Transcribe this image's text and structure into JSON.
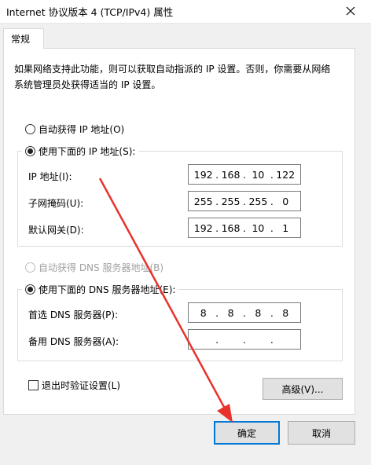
{
  "window": {
    "title": "Internet 协议版本 4 (TCP/IPv4) 属性"
  },
  "tabs": [
    {
      "label": "常规"
    }
  ],
  "description": "如果网络支持此功能，则可以获取自动指派的 IP 设置。否则，你需要从网络系统管理员处获得适当的 IP 设置。",
  "ip_section": {
    "auto_label": "自动获得 IP 地址(O)",
    "manual_label": "使用下面的 IP 地址(S):",
    "fields": [
      {
        "label": "IP 地址(I):",
        "octets": [
          "192",
          "168",
          "10",
          "122"
        ]
      },
      {
        "label": "子网掩码(U):",
        "octets": [
          "255",
          "255",
          "255",
          "0"
        ]
      },
      {
        "label": "默认网关(D):",
        "octets": [
          "192",
          "168",
          "10",
          "1"
        ]
      }
    ]
  },
  "dns_section": {
    "auto_label": "自动获得 DNS 服务器地址(B)",
    "manual_label": "使用下面的 DNS 服务器地址(E):",
    "fields": [
      {
        "label": "首选 DNS 服务器(P):",
        "octets": [
          "8",
          "8",
          "8",
          "8"
        ]
      },
      {
        "label": "备用 DNS 服务器(A):",
        "octets": [
          "",
          "",
          "",
          ""
        ]
      }
    ]
  },
  "validate_label": "退出时验证设置(L)",
  "advanced_label": "高级(V)...",
  "ok_label": "确定",
  "cancel_label": "取消",
  "colors": {
    "arrow": "#e8322b",
    "accent": "#0078d7",
    "dialog_bg": "#f0f0f0"
  },
  "icons": {
    "close": "close-icon",
    "annotation": "red-arrow-annotation"
  }
}
